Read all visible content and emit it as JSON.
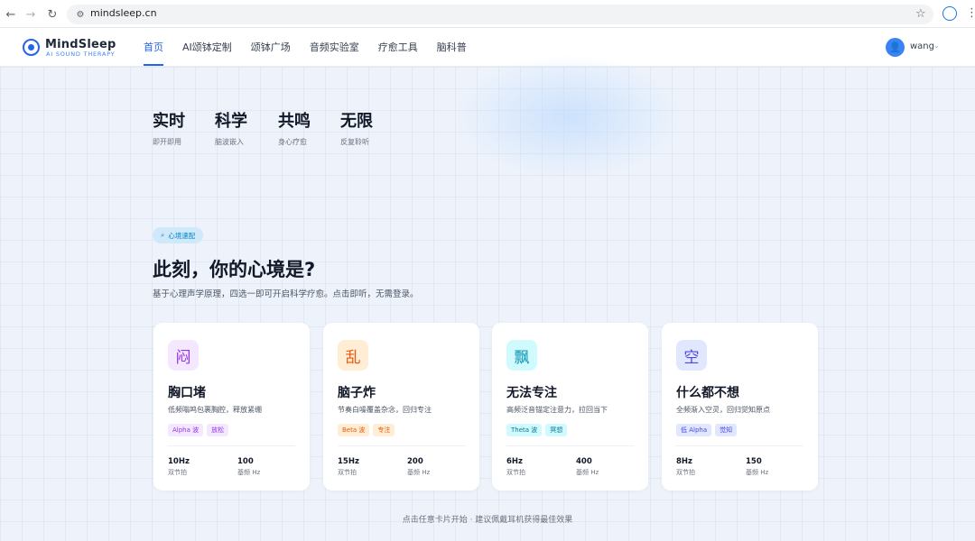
{
  "browser": {
    "url": "mindsleep.cn"
  },
  "header": {
    "logo_title": "MindSleep",
    "logo_sub": "AI SOUND THERAPY",
    "nav": [
      "首页",
      "AI颂钵定制",
      "颂钵广场",
      "音频实验室",
      "疗愈工具",
      "脑科普"
    ],
    "active_index": 0,
    "user_name": "wang"
  },
  "stats": [
    {
      "title": "实时",
      "sub": "即开即用"
    },
    {
      "title": "科学",
      "sub": "脑波嵌入"
    },
    {
      "title": "共鸣",
      "sub": "身心疗愈"
    },
    {
      "title": "无限",
      "sub": "反复聆听"
    }
  ],
  "section": {
    "chip": "心境速配",
    "headline": "此刻，你的心境是?",
    "subline": "基于心理声学原理，四选一即可开启科学疗愈。点击即听，无需登录。"
  },
  "cards": [
    {
      "icon_char": "闷",
      "icon_bg": "#f3e8ff",
      "icon_color": "#9333ea",
      "title": "胸口堵",
      "desc": "低频嗡鸣包裹胸腔，释放紧绷",
      "tags": [
        {
          "label": "Alpha 波",
          "bg": "#f3e8ff",
          "color": "#9333ea"
        },
        {
          "label": "放松",
          "bg": "#f3e8ff",
          "color": "#9333ea"
        }
      ],
      "beat_value": "10Hz",
      "beat_label": "双节拍",
      "base_value": "100",
      "base_label": "基频 Hz"
    },
    {
      "icon_char": "乱",
      "icon_bg": "#ffedd5",
      "icon_color": "#ea580c",
      "title": "脑子炸",
      "desc": "节奏白噪覆盖杂念，回归专注",
      "tags": [
        {
          "label": "Beta 波",
          "bg": "#ffedd5",
          "color": "#ea580c"
        },
        {
          "label": "专注",
          "bg": "#ffedd5",
          "color": "#ea580c"
        }
      ],
      "beat_value": "15Hz",
      "beat_label": "双节拍",
      "base_value": "200",
      "base_label": "基频 Hz"
    },
    {
      "icon_char": "飘",
      "icon_bg": "#cffafe",
      "icon_color": "#0891b2",
      "title": "无法专注",
      "desc": "高频泛音锚定注意力，拉回当下",
      "tags": [
        {
          "label": "Theta 波",
          "bg": "#cffafe",
          "color": "#0e7490"
        },
        {
          "label": "冥想",
          "bg": "#cffafe",
          "color": "#0e7490"
        }
      ],
      "beat_value": "6Hz",
      "beat_label": "双节拍",
      "base_value": "400",
      "base_label": "基频 Hz"
    },
    {
      "icon_char": "空",
      "icon_bg": "#e0e7ff",
      "icon_color": "#4f46e5",
      "title": "什么都不想",
      "desc": "全频渐入空灵，回归觉知原点",
      "tags": [
        {
          "label": "低 Alpha",
          "bg": "#e0e7ff",
          "color": "#4f46e5"
        },
        {
          "label": "觉知",
          "bg": "#e0e7ff",
          "color": "#4f46e5"
        }
      ],
      "beat_value": "8Hz",
      "beat_label": "双节拍",
      "base_value": "150",
      "base_label": "基频 Hz"
    }
  ],
  "footer_note": "点击任意卡片开始 · 建议佩戴耳机获得最佳效果"
}
